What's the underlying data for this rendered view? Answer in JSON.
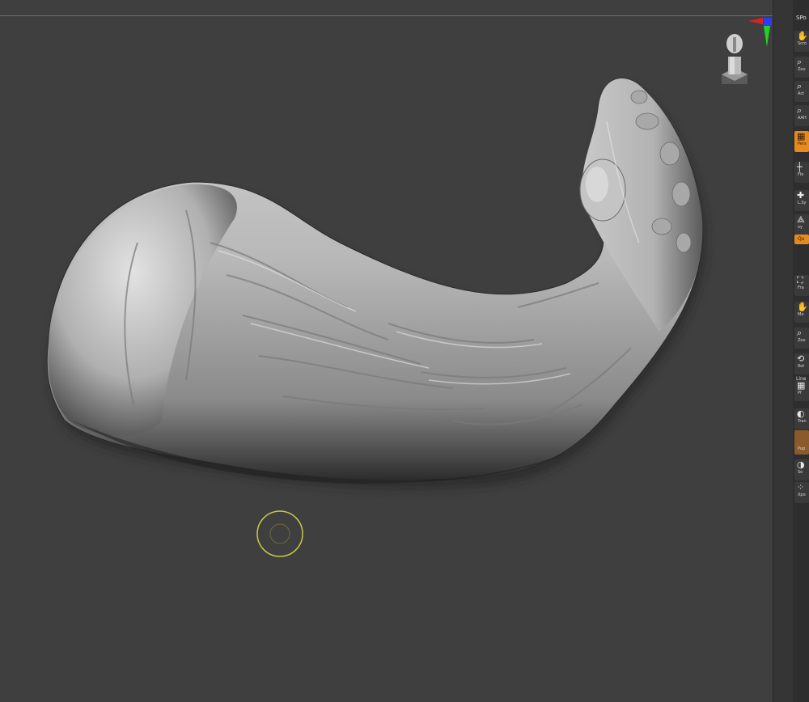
{
  "shelf": {
    "top_label": "SPo",
    "tools": [
      {
        "name": "tool-scroll",
        "icon": "hand-icon",
        "glyph": "✋",
        "label": "Scro"
      },
      {
        "name": "tool-zoom",
        "icon": "magnifier-icon",
        "glyph": "⌕",
        "label": "Zoo"
      },
      {
        "name": "tool-actual",
        "icon": "magnifier-icon",
        "glyph": "⌕",
        "label": "Act"
      },
      {
        "name": "tool-aahalf",
        "icon": "magnifier-icon",
        "glyph": "⌕",
        "label": "AAH"
      },
      {
        "name": "tool-persp",
        "icon": "grid-icon",
        "glyph": "▦",
        "label": "Pers"
      },
      {
        "name": "tool-floor",
        "icon": "floor-icon",
        "glyph": "┼",
        "label": "Flo"
      },
      {
        "name": "tool-lsym",
        "icon": "symmetry-icon",
        "glyph": "✚",
        "label": "L.Sy"
      },
      {
        "name": "tool-xyz",
        "icon": "axis-icon",
        "glyph": "⟁",
        "label": "xy"
      },
      {
        "name": "tool-frame",
        "icon": "frame-icon",
        "glyph": "⛶",
        "label": "Fra"
      },
      {
        "name": "tool-move",
        "icon": "hand-icon",
        "glyph": "✋",
        "label": "Mo"
      },
      {
        "name": "tool-zoom3d",
        "icon": "magnifier-icon",
        "glyph": "⌕",
        "label": "Zoo"
      },
      {
        "name": "tool-rotate",
        "icon": "rotate-icon",
        "glyph": "⟲",
        "label": "Rot"
      },
      {
        "name": "tool-polyf",
        "icon": "polyframe-icon",
        "glyph": "▦",
        "label": "Pf"
      },
      {
        "name": "tool-transp",
        "icon": "transparency-icon",
        "glyph": "◐",
        "label": "Tran"
      },
      {
        "name": "tool-solo",
        "icon": "solo-icon",
        "glyph": "◑",
        "label": "So"
      },
      {
        "name": "tool-xpose",
        "icon": "xpose-icon",
        "glyph": "⁘",
        "label": "Xpo"
      }
    ],
    "quick_label": "Qu",
    "line_label": "Line",
    "brush_label": "Pup"
  },
  "colors": {
    "viewport_bg": "#3f3f3f",
    "accent_orange": "#e78a1e",
    "cursor_yellow": "#c9c94a",
    "axis_x": "#e02020",
    "axis_y": "#22d022",
    "axis_z": "#2a3aff"
  }
}
